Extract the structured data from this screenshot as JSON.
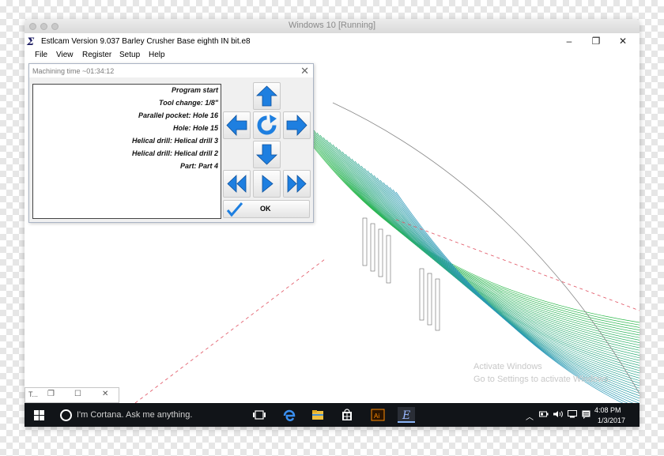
{
  "vm": {
    "title": "Windows 10 [Running]"
  },
  "app": {
    "icon": "estlcam-icon",
    "title": "Estlcam Version 9.037 Barley Crusher Base eighth IN bit.e8",
    "controls": {
      "minimize": "–",
      "restore": "❐",
      "close": "✕"
    }
  },
  "menu": [
    "File",
    "View",
    "Register",
    "Setup",
    "Help"
  ],
  "dialog": {
    "title": "Machining time ~01:34:12",
    "close": "✕",
    "items": [
      "Program start",
      "Tool change: 1/8\"",
      "Parallel pocket: Hole 16",
      "Hole: Hole 15",
      "Helical drill: Helical drill 3",
      "Helical drill: Helical drill 2",
      "Part: Part 4"
    ],
    "nav_icons": [
      "arrow-up-icon",
      "arrow-left-icon",
      "rotate-icon",
      "arrow-right-icon",
      "arrow-down-icon",
      "rewind-icon",
      "play-icon",
      "fast-forward-icon"
    ],
    "ok_label": "OK"
  },
  "watermark": {
    "line1": "Activate Windows",
    "line2": "Go to Settings to activate Windows."
  },
  "taskbar": {
    "cortana_placeholder": "I'm Cortana. Ask me anything.",
    "time": "4:08 PM",
    "date": "1/3/2017",
    "tray_up": "︿",
    "apps": [
      "task-view-icon",
      "edge-icon",
      "file-explorer-icon",
      "store-icon",
      "illustrator-icon",
      "estlcam-icon"
    ]
  },
  "mini_window": {
    "title": "T...",
    "restore": "❐",
    "maximize": "☐",
    "close": "✕"
  },
  "colors": {
    "arrow_blue": "#1e7fe0",
    "path_green": "#2bb84a",
    "path_teal": "#2a98b8",
    "dash_red": "#e05060",
    "taskbar": "#111418"
  }
}
